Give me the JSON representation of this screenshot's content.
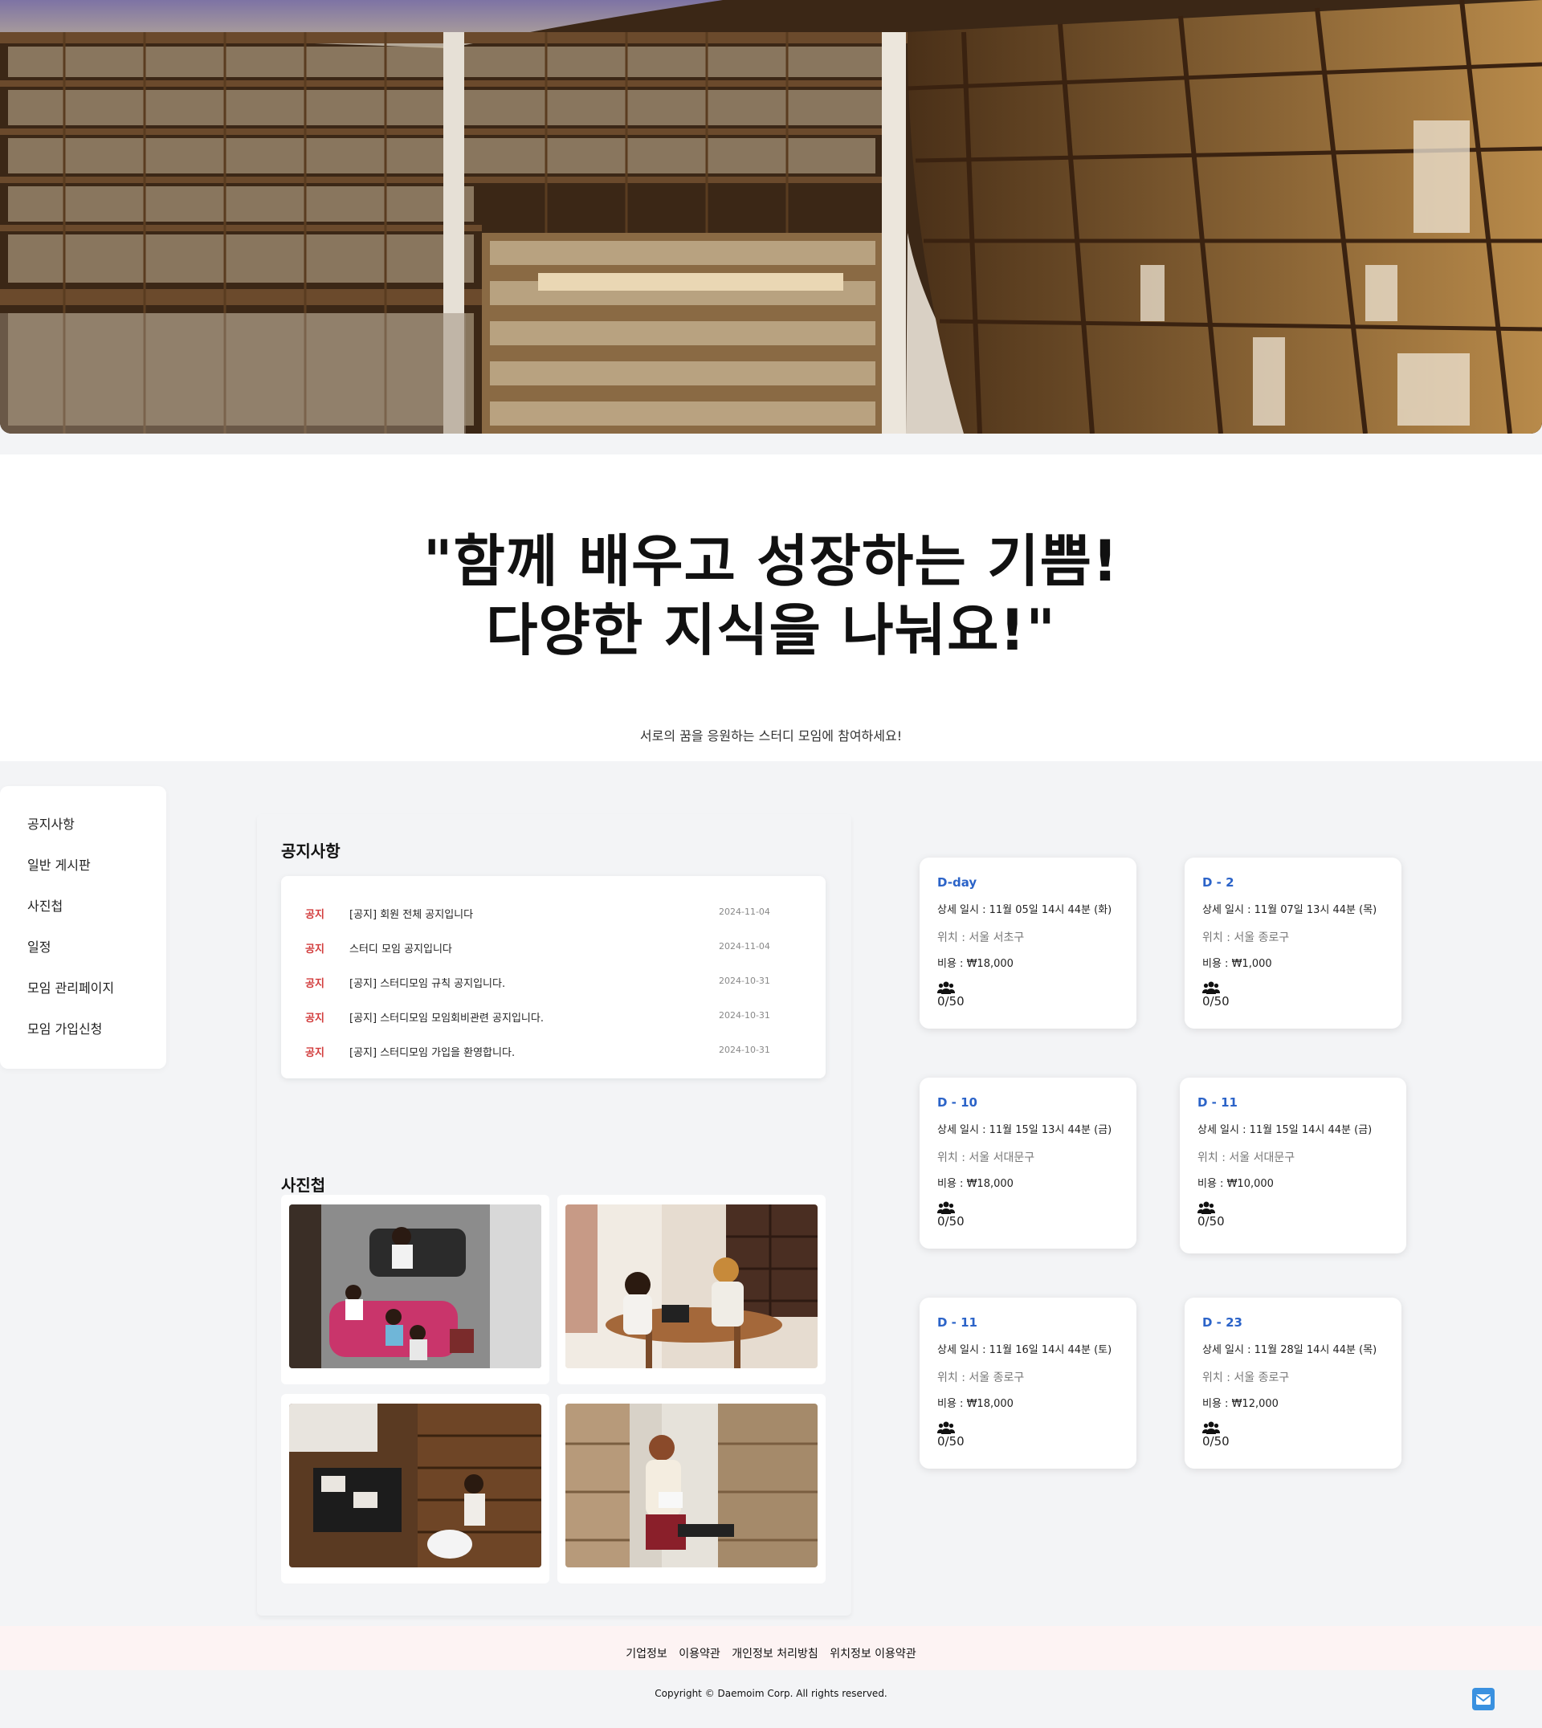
{
  "hero": {
    "image": "library-bookshelves-photo"
  },
  "quote": {
    "line1": "\"함께 배우고 성장하는 기쁨!",
    "line2": "다양한 지식을 나눠요!\"",
    "subtitle": "서로의 꿈을 응원하는 스터디 모임에 참여하세요!"
  },
  "sidebar": {
    "items": [
      {
        "label": "공지사항"
      },
      {
        "label": "일반 게시판"
      },
      {
        "label": "사진첩"
      },
      {
        "label": "일정"
      },
      {
        "label": "모임 관리페이지"
      },
      {
        "label": "모임 가입신청"
      }
    ]
  },
  "notices": {
    "title": "공지사항",
    "rows": [
      {
        "tag": "공지",
        "title": "[공지] 회원 전체 공지입니다",
        "date": "2024-11-04"
      },
      {
        "tag": "공지",
        "title": "스터디 모임 공지입니다",
        "date": "2024-11-04"
      },
      {
        "tag": "공지",
        "title": "[공지] 스터디모임 규칙 공지입니다.",
        "date": "2024-10-31"
      },
      {
        "tag": "공지",
        "title": "[공지] 스터디모임 모임회비관련 공지입니다.",
        "date": "2024-10-31"
      },
      {
        "tag": "공지",
        "title": "[공지] 스터디모임 가입을 환영합니다.",
        "date": "2024-10-31"
      }
    ]
  },
  "gallery": {
    "title": "사진첩"
  },
  "schedules": [
    {
      "dday": "D-day",
      "datetime": "상세 일시 : 11월 05일 14시 44분 (화)",
      "location": "위치 : 서울 서초구",
      "fee": "비용 : ₩18,000",
      "count": "0/50"
    },
    {
      "dday": "D - 2",
      "datetime": "상세 일시 : 11월 07일 13시 44분 (목)",
      "location": "위치 : 서울 종로구",
      "fee": "비용 : ₩1,000",
      "count": "0/50"
    },
    {
      "dday": "D - 10",
      "datetime": "상세 일시 : 11월 15일 13시 44분 (금)",
      "location": "위치 : 서울 서대문구",
      "fee": "비용 : ₩18,000",
      "count": "0/50"
    },
    {
      "dday": "D - 11",
      "datetime": "상세 일시 : 11월 15일 14시 44분 (금)",
      "location": "위치 : 서울 서대문구",
      "fee": "비용 : ₩10,000",
      "count": "0/50"
    },
    {
      "dday": "D - 11",
      "datetime": "상세 일시 : 11월 16일 14시 44분 (토)",
      "location": "위치 : 서울 종로구",
      "fee": "비용 : ₩18,000",
      "count": "0/50"
    },
    {
      "dday": "D - 23",
      "datetime": "상세 일시 : 11월 28일 14시 44분 (목)",
      "location": "위치 : 서울 종로구",
      "fee": "비용 : ₩12,000",
      "count": "0/50"
    }
  ],
  "footer": {
    "links": [
      "기업정보",
      "이용약관",
      "개인정보 처리방침",
      "위치정보 이용약관"
    ],
    "copyright": "Copyright © Daemoim Corp. All rights reserved."
  },
  "colors": {
    "notice_tag": "#d23c3c",
    "dday": "#2b63c8",
    "footer_bg": "#fdf3f3",
    "mail_icon": "#3a91e0"
  }
}
